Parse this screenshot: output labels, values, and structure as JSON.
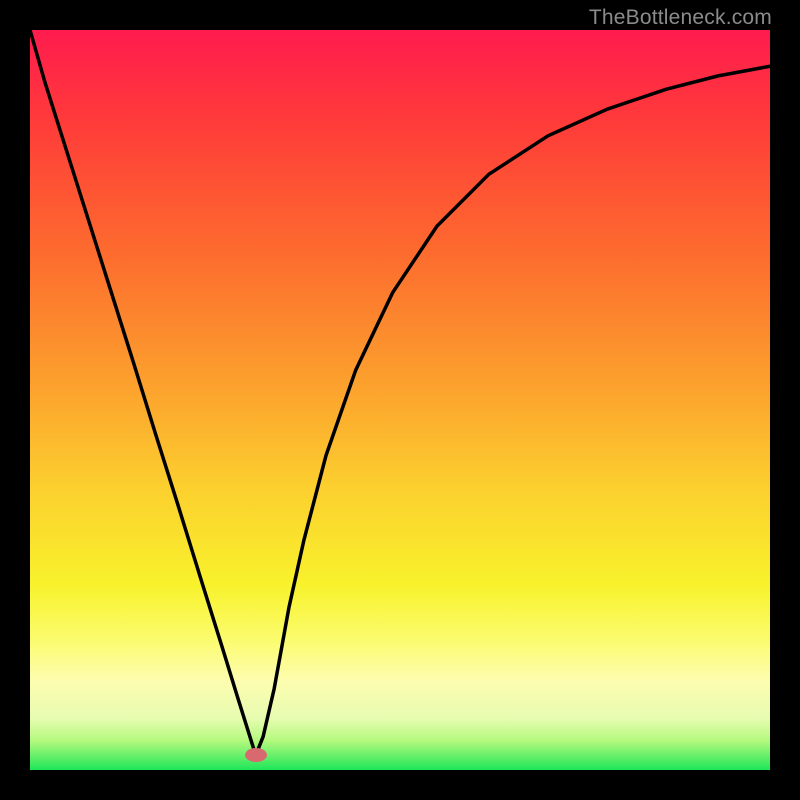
{
  "watermark_text": "TheBottleneck.com",
  "chart_data": {
    "type": "line",
    "title": "",
    "xlabel": "",
    "ylabel": "",
    "xlim": [
      0,
      100
    ],
    "ylim": [
      0,
      100
    ],
    "gradient_stops": [
      {
        "pct": 0,
        "color": "#ff1b4e"
      },
      {
        "pct": 12,
        "color": "#ff3a3a"
      },
      {
        "pct": 30,
        "color": "#fd6b2e"
      },
      {
        "pct": 48,
        "color": "#fca12d"
      },
      {
        "pct": 62,
        "color": "#fcd02e"
      },
      {
        "pct": 75,
        "color": "#f8f22c"
      },
      {
        "pct": 82,
        "color": "#fbfb6a"
      },
      {
        "pct": 88,
        "color": "#fdfdb0"
      },
      {
        "pct": 93,
        "color": "#e7fcb0"
      },
      {
        "pct": 96,
        "color": "#b5f97e"
      },
      {
        "pct": 98,
        "color": "#6af06a"
      },
      {
        "pct": 100,
        "color": "#1ee65a"
      }
    ],
    "series": [
      {
        "name": "bottleneck-curve",
        "color": "#000000",
        "x": [
          0,
          2,
          5,
          8,
          11,
          14,
          17,
          20,
          23,
          26,
          28,
          29.5,
          30.5,
          31.5,
          33,
          34,
          35,
          37,
          40,
          44,
          49,
          55,
          62,
          70,
          78,
          86,
          93,
          100
        ],
        "y": [
          100,
          93,
          83.5,
          74,
          64.5,
          55,
          45.3,
          35.8,
          26.1,
          16.5,
          10,
          5.2,
          2.0,
          4.5,
          11,
          16.5,
          22,
          31,
          42.5,
          54,
          64.5,
          73.5,
          80.5,
          85.7,
          89.3,
          92,
          93.8,
          95.1
        ]
      }
    ],
    "annotations": [
      {
        "name": "optimal-marker",
        "x": 30.5,
        "y": 2.0,
        "color": "#d86a6f"
      }
    ]
  }
}
